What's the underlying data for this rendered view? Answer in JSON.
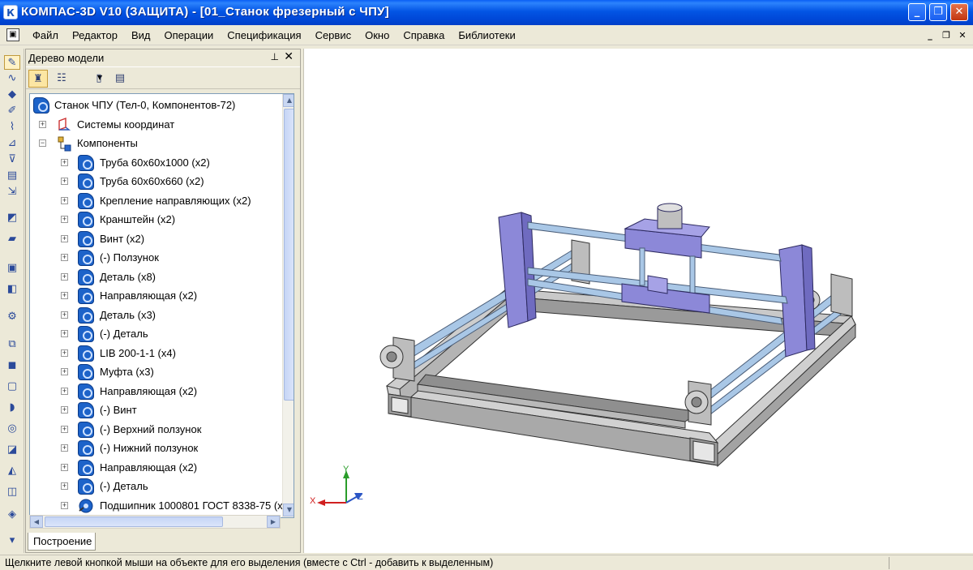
{
  "window": {
    "title": "КОМПАС-3D V10 (ЗАЩИТА) - [01_Станок фрезерный с ЧПУ]",
    "app_icon": "К"
  },
  "menu": {
    "items": [
      "Файл",
      "Редактор",
      "Вид",
      "Операции",
      "Спецификация",
      "Сервис",
      "Окно",
      "Справка",
      "Библиотеки"
    ]
  },
  "panel": {
    "title": "Дерево модели",
    "tab_label": "Построение"
  },
  "tree": {
    "root": "Станок ЧПУ (Тел-0, Компонентов-72)",
    "coord_systems": "Системы координат",
    "components_label": "Компоненты",
    "components": [
      "Труба 60х60х1000 (x2)",
      "Труба 60х60х660 (x2)",
      "Крепление направляющих (x2)",
      "Кранштейн (x2)",
      "Винт (x2)",
      "(-) Ползунок",
      "Деталь (x8)",
      "Направляющая (x2)",
      "Деталь (x3)",
      "(-) Деталь",
      "LIB 200-1-1 (x4)",
      "Муфта (x3)",
      "Направляющая (x2)",
      "(-) Винт",
      "(-) Верхний ползунок",
      "(-) Нижний ползунок",
      "Направляющая (x2)",
      "(-) Деталь",
      "Подшипник 1000801 ГОСТ 8338-75 (x"
    ]
  },
  "axes": {
    "x": "X",
    "y": "Y",
    "z": "Z"
  },
  "status": {
    "text": "Щелкните левой кнопкой мыши на объекте для его выделения (вместе с Ctrl - добавить к выделенным)"
  },
  "colors": {
    "titlebar": "#0054e3",
    "frame": "#c0c0c0",
    "gantry": "#8c88d8",
    "rail": "#a9c7e6",
    "component_icon": "#1d63c9"
  }
}
